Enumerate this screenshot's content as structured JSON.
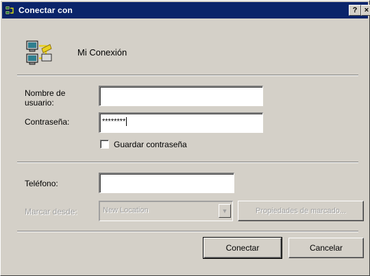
{
  "window": {
    "title": "Conectar con",
    "help_label": "?",
    "close_label": "×"
  },
  "connection": {
    "name": "Mi Conexión",
    "icon": "dialup-connection-icon"
  },
  "fields": {
    "username_label_line1": "Nombre de",
    "username_label_line2": "usuario:",
    "username_value": "",
    "password_label": "Contraseña:",
    "password_value": "********",
    "save_password_label": "Guardar contraseña",
    "save_password_checked": false,
    "phone_label": "Teléfono:",
    "phone_value": "",
    "dial_from_label": "Marcar desde:",
    "dial_from_value": "New Location"
  },
  "buttons": {
    "dialing_properties": "Propiedades de marcado...",
    "connect": "Conectar",
    "cancel": "Cancelar"
  },
  "colors": {
    "titlebar": "#0a246a",
    "face": "#d4d0c8",
    "disabled_text": "#a0a0a0"
  }
}
